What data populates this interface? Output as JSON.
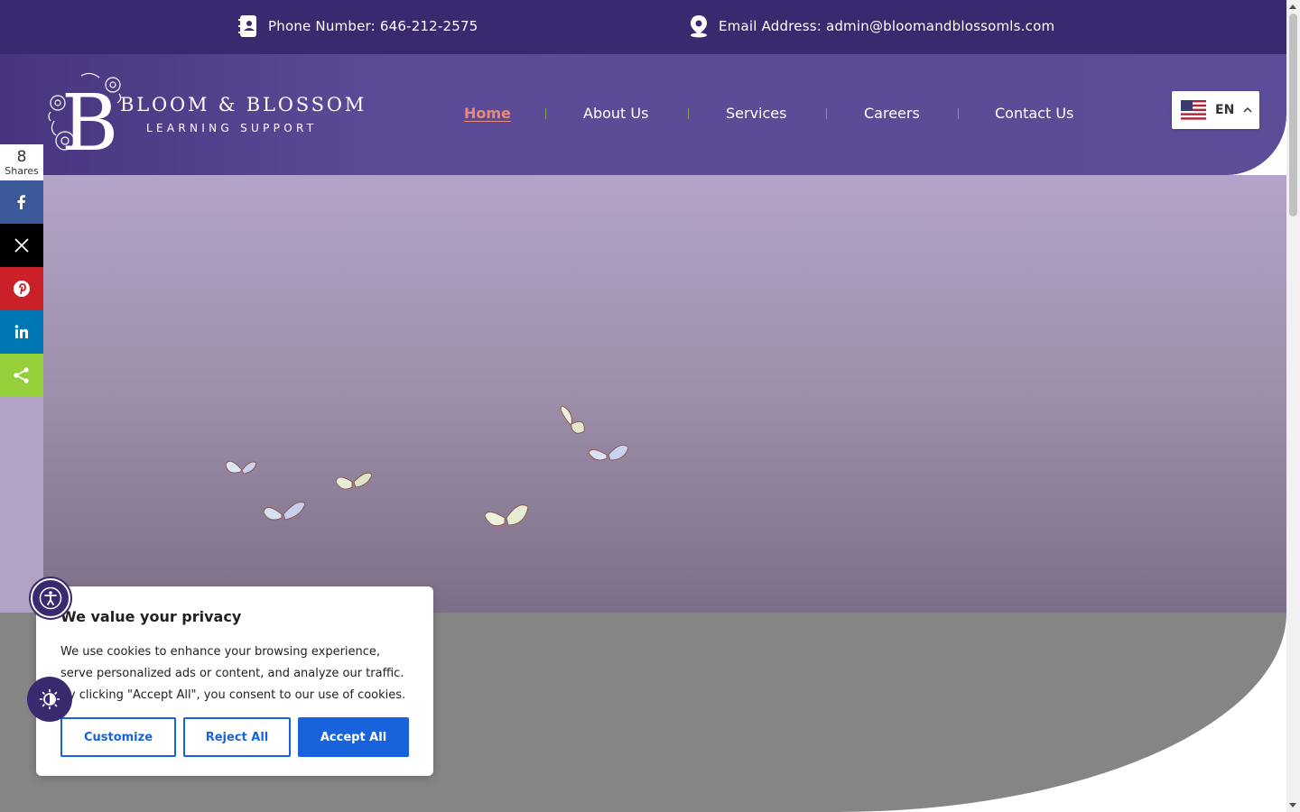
{
  "topbar": {
    "phone": "Phone Number: 646-212-2575",
    "email": "Email Address: admin@bloomandblossomls.com",
    "phone_icon": "contact-book-icon",
    "email_icon": "map-pin-icon"
  },
  "logo": {
    "letter": "B",
    "name": "BLOOM & BLOSSOM",
    "subtitle": "LEARNING SUPPORT"
  },
  "nav": {
    "items": [
      {
        "label": "Home",
        "active": true
      },
      {
        "label": "About Us"
      },
      {
        "label": "Services"
      },
      {
        "label": "Careers"
      },
      {
        "label": "Contact Us"
      }
    ]
  },
  "language": {
    "code": "EN",
    "flag_icon": "us-flag-icon"
  },
  "share": {
    "count": "8",
    "label": "Shares",
    "buttons": [
      {
        "name": "facebook",
        "color": "#3b5998"
      },
      {
        "name": "x",
        "color": "#000000"
      },
      {
        "name": "pinterest",
        "color": "#cb2027"
      },
      {
        "name": "linkedin",
        "color": "#0077b5"
      },
      {
        "name": "share",
        "color": "#95d03a"
      }
    ]
  },
  "cookie": {
    "title": "We value your privacy",
    "body": "We use cookies to enhance your browsing experience, serve personalized ads or content, and analyze our traffic. By clicking \"Accept All\", you consent to our use of cookies.",
    "customize": "Customize",
    "reject": "Reject All",
    "accept": "Accept All"
  },
  "colors": {
    "brand": "#39296f",
    "header": "#5d4d99",
    "nav_active": "#e58b7a",
    "accept": "#1863dc"
  }
}
